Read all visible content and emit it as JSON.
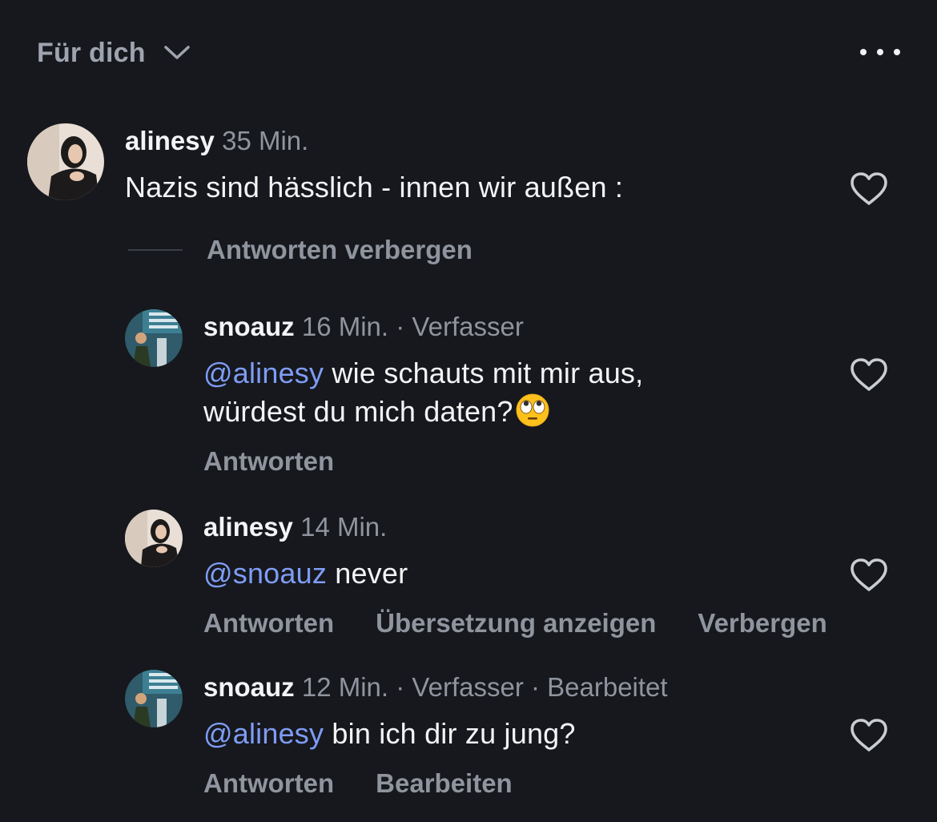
{
  "header": {
    "feed_label": "Für dich"
  },
  "comments": [
    {
      "username": "alinesy",
      "time": "35 Min.",
      "text": "Nazis sind hässlich - innen wir außen :"
    }
  ],
  "hide_replies_label": "Antworten verbergen",
  "replies": [
    {
      "username": "snoauz",
      "time": "16 Min.",
      "tags": "· Verfasser",
      "mention": "@alinesy",
      "text_line1": "wie schauts mit mir aus,",
      "text_line2": "würdest du mich daten?",
      "emoji": "face-with-rolling-eyes",
      "actions": [
        "Antworten"
      ]
    },
    {
      "username": "alinesy",
      "time": "14 Min.",
      "tags": "",
      "mention": "@snoauz",
      "text_line1": "never",
      "actions": [
        "Antworten",
        "Übersetzung anzeigen",
        "Verbergen"
      ]
    },
    {
      "username": "snoauz",
      "time": "12 Min.",
      "tags": "· Verfasser · Bearbeitet",
      "mention": "@alinesy",
      "text_line1": "bin ich dir zu jung?",
      "actions": [
        "Antworten",
        "Bearbeiten"
      ]
    }
  ],
  "icons": {
    "header": [
      "chevron-down-icon",
      "more-options-icon"
    ],
    "comment": [
      "heart-icon"
    ]
  },
  "colors": {
    "background": "#16181d",
    "mention": "#7f9cf5",
    "secondary_text": "#8f949e"
  }
}
